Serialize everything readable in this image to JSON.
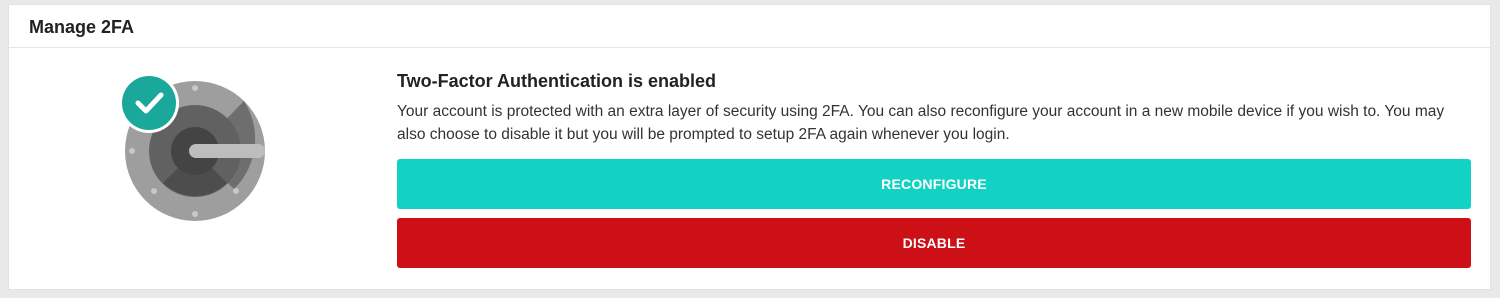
{
  "header": {
    "title": "Manage 2FA"
  },
  "status": {
    "heading": "Two-Factor Authentication is enabled",
    "description": "Your account is protected with an extra layer of security using 2FA. You can also reconfigure your account in a new mobile device if you wish to. You may also choose to disable it but you will be prompted to setup 2FA again whenever you login."
  },
  "actions": {
    "reconfigure_label": "RECONFIGURE",
    "disable_label": "DISABLE"
  },
  "icons": {
    "illustration": "google-authenticator-icon",
    "badge": "check-circle-icon"
  },
  "colors": {
    "reconfigure": "#12d2c3",
    "disable": "#cc1016",
    "badge": "#1aa89a",
    "authenticator_outer": "#9e9e9e",
    "authenticator_inner": "#616161"
  }
}
